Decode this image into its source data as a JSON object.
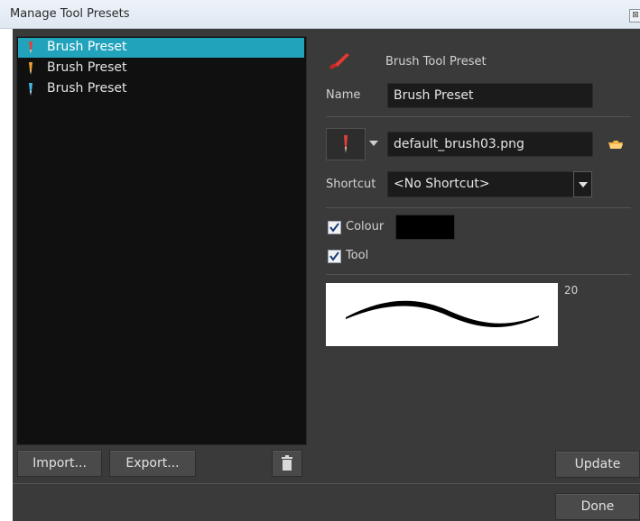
{
  "window": {
    "title": "Manage Tool Presets",
    "close_glyph": "⊠"
  },
  "presets": [
    {
      "label": "Brush Preset",
      "icon": "brush-red-icon",
      "color": "#e0403a",
      "selected": true
    },
    {
      "label": "Brush Preset",
      "icon": "brush-orange-icon",
      "color": "#f0a030",
      "selected": false
    },
    {
      "label": "Brush Preset",
      "icon": "brush-blue-icon",
      "color": "#45b6e6",
      "selected": false
    }
  ],
  "left_buttons": {
    "import": "Import...",
    "export": "Export...",
    "delete_icon": "trash-icon"
  },
  "details": {
    "header": "Brush Tool Preset",
    "name_label": "Name",
    "name_value": "Brush Preset",
    "texture_file": "default_brush03.png",
    "shortcut_label": "Shortcut",
    "shortcut_value": "<No Shortcut>",
    "colour_label": "Colour",
    "colour_checked": true,
    "colour_swatch": "#000000",
    "tool_label": "Tool",
    "tool_checked": true,
    "stroke_size": "20"
  },
  "buttons": {
    "update": "Update",
    "done": "Done"
  },
  "colors": {
    "selection": "#22a3bc",
    "panel": "#3a3a3a",
    "list_bg": "#101010"
  }
}
